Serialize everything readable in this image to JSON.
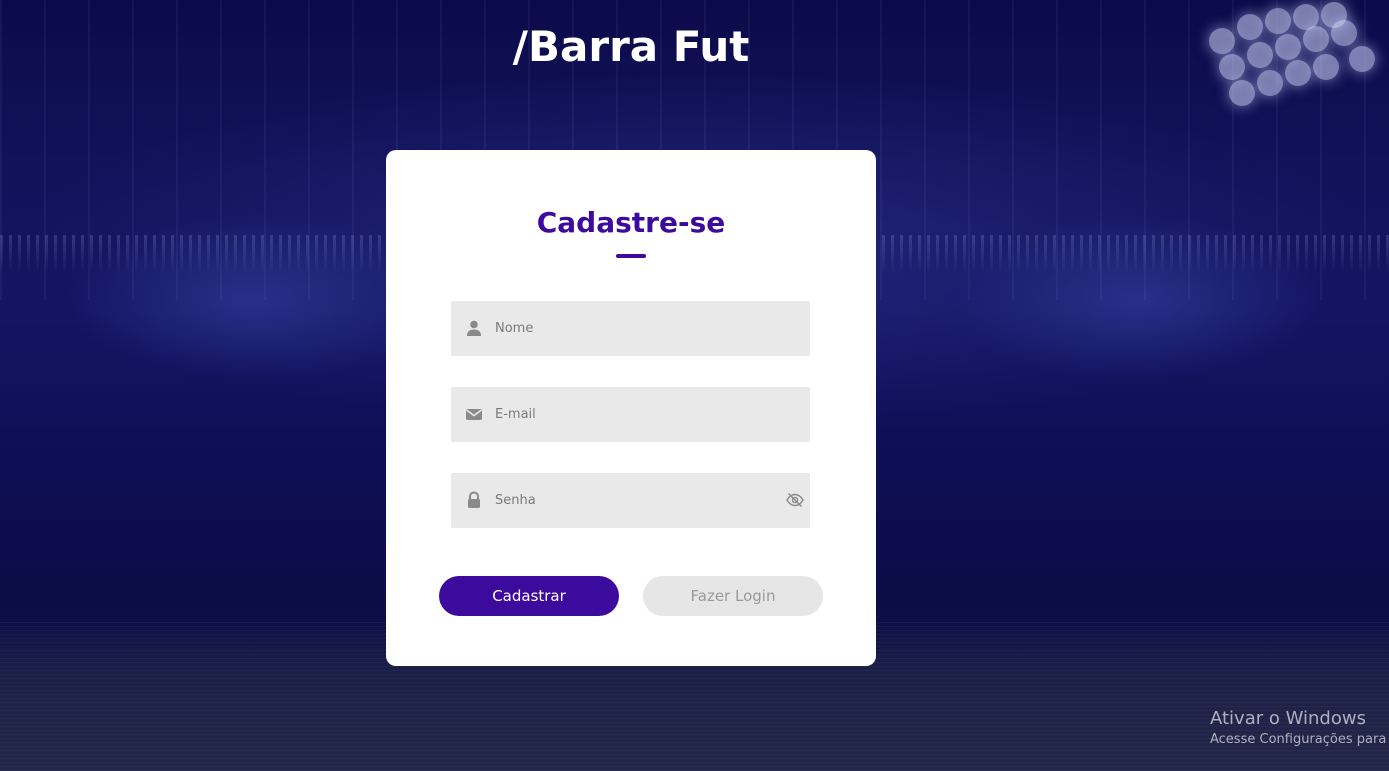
{
  "brand": {
    "title": "/Barra Fut"
  },
  "form": {
    "title": "Cadastre-se",
    "fields": {
      "name": {
        "placeholder": "Nome",
        "value": "",
        "icon": "user-icon"
      },
      "email": {
        "placeholder": "E-mail",
        "value": "",
        "icon": "envelope-icon"
      },
      "password": {
        "placeholder": "Senha",
        "value": "",
        "icon": "lock-icon",
        "toggle_icon": "eye-slash-icon"
      }
    },
    "buttons": {
      "register": "Cadastrar",
      "login": "Fazer Login"
    }
  },
  "watermark": {
    "line1": "Ativar o Windows",
    "line2": "Acesse Configurações para"
  },
  "colors": {
    "accent": "#3d0a9e",
    "card": "#ffffff",
    "field_bg": "#e9e9e9",
    "background": "#12125a"
  }
}
